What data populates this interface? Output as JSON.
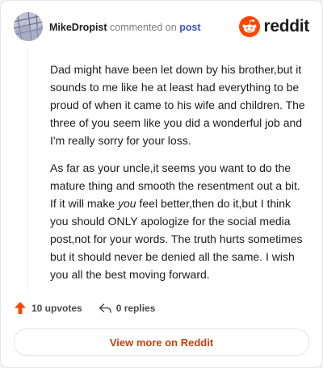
{
  "header": {
    "author": "MikeDropist",
    "action": "commented on",
    "post_link": "post",
    "brand": "reddit",
    "avatar_icon": "user-avatar",
    "logo_icon": "reddit-snoo-icon"
  },
  "comment": {
    "paragraphs": [
      "Dad might have been let down by his brother,but it sounds to me like he at least had everything to be proud of when it came to his wife and children. The three of you seem like you did a wonderful job and I'm really sorry for your loss."
    ],
    "p2_before": "As far as your uncle,it seems you want to do the mature thing and smooth the resentment out a bit. If it will make ",
    "p2_emphasis": "you",
    "p2_after": " feel better,then do it,but I think you should ONLY apologize for the social media post,not for your words. The truth hurts sometimes but it should never be denied all the same. I wish you all the best moving forward."
  },
  "actions": {
    "upvotes": "10 upvotes",
    "replies": "0 replies",
    "upvote_icon": "upvote-arrow-icon",
    "reply_icon": "reply-arrow-icon"
  },
  "view_button": "View more on Reddit",
  "colors": {
    "brand_orange": "#ff4500",
    "link_blue": "#3c56b5",
    "button_text": "#c4410b"
  }
}
